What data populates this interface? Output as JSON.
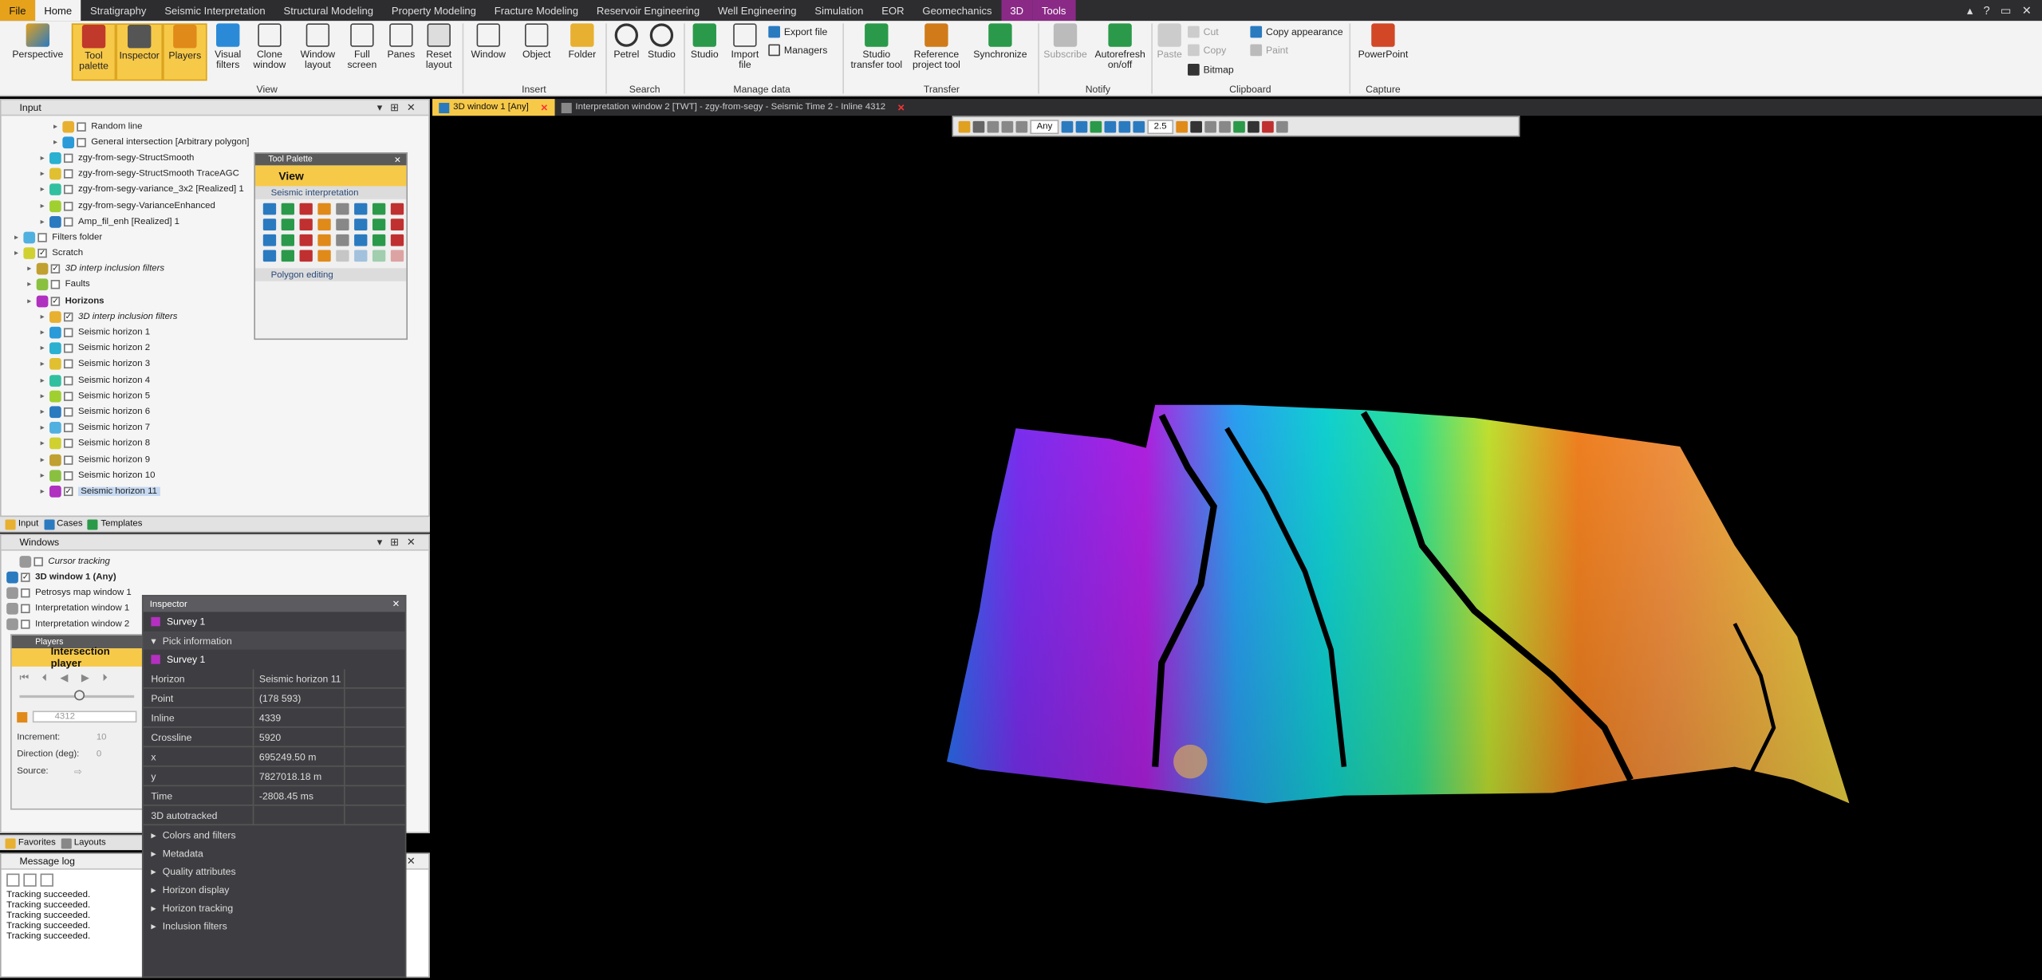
{
  "menu": {
    "tabs": [
      "File",
      "Home",
      "Stratigraphy",
      "Seismic Interpretation",
      "Structural Modeling",
      "Property Modeling",
      "Fracture Modeling",
      "Reservoir Engineering",
      "Well Engineering",
      "Simulation",
      "EOR",
      "Geomechanics",
      "3D",
      "Tools"
    ]
  },
  "ribbon": {
    "buttons": {
      "perspective": "Perspective",
      "tool_palette": "Tool palette",
      "inspector": "Inspector",
      "players": "Players",
      "visual_filters": "Visual filters",
      "clone_window": "Clone window",
      "window_layout": "Window layout",
      "full_screen": "Full screen",
      "panes": "Panes",
      "reset_layout": "Reset layout",
      "window": "Window",
      "object": "Object",
      "folder": "Folder",
      "petrel": "Petrel",
      "studio": "Studio",
      "studio2": "Studio",
      "import_file": "Import file",
      "export_file": "Export file",
      "managers": "Managers",
      "studio_transfer": "Studio transfer tool",
      "reference_project": "Reference project tool",
      "synchronize": "Synchronize",
      "subscribe": "Subscribe",
      "autorefresh": "Autorefresh on/off",
      "paste": "Paste",
      "cut": "Cut",
      "copy": "Copy",
      "bitmap": "Bitmap",
      "copy_appearance": "Copy appearance",
      "paint": "Paint",
      "powerpoint": "PowerPoint"
    },
    "groups": [
      "View",
      "Insert",
      "Search",
      "Manage data",
      "Transfer",
      "Notify",
      "Clipboard",
      "Capture"
    ]
  },
  "input_pane": {
    "title": "Input",
    "rows": [
      {
        "label": "Random line",
        "indent": 4,
        "italic": false,
        "checked": false
      },
      {
        "label": "General intersection [Arbitrary polygon]",
        "indent": 4,
        "italic": false,
        "checked": false
      },
      {
        "label": "zgy-from-segy-StructSmooth",
        "indent": 3,
        "italic": false,
        "checked": false
      },
      {
        "label": "zgy-from-segy-StructSmooth TraceAGC",
        "indent": 3,
        "italic": false,
        "checked": false
      },
      {
        "label": "zgy-from-segy-variance_3x2 [Realized] 1",
        "indent": 3,
        "italic": false,
        "checked": false
      },
      {
        "label": "zgy-from-segy-VarianceEnhanced",
        "indent": 3,
        "italic": false,
        "checked": false
      },
      {
        "label": "Amp_fil_enh [Realized] 1",
        "indent": 3,
        "italic": false,
        "checked": false
      },
      {
        "label": "Filters folder",
        "indent": 1,
        "italic": false,
        "checked": false
      },
      {
        "label": "Scratch",
        "indent": 1,
        "italic": false,
        "checked": true
      },
      {
        "label": "3D interp inclusion filters",
        "indent": 2,
        "italic": true,
        "checked": true
      },
      {
        "label": "Faults",
        "indent": 2,
        "italic": false,
        "checked": false
      },
      {
        "label": "Horizons",
        "indent": 2,
        "italic": false,
        "checked": true
      },
      {
        "label": "3D interp inclusion filters",
        "indent": 3,
        "italic": true,
        "checked": true
      },
      {
        "label": "Seismic horizon 1",
        "indent": 3,
        "italic": false,
        "checked": false
      },
      {
        "label": "Seismic horizon 2",
        "indent": 3,
        "italic": false,
        "checked": false
      },
      {
        "label": "Seismic horizon 3",
        "indent": 3,
        "italic": false,
        "checked": false
      },
      {
        "label": "Seismic horizon 4",
        "indent": 3,
        "italic": false,
        "checked": false
      },
      {
        "label": "Seismic horizon 5",
        "indent": 3,
        "italic": false,
        "checked": false
      },
      {
        "label": "Seismic horizon 6",
        "indent": 3,
        "italic": false,
        "checked": false
      },
      {
        "label": "Seismic horizon 7",
        "indent": 3,
        "italic": false,
        "checked": false
      },
      {
        "label": "Seismic horizon 8",
        "indent": 3,
        "italic": false,
        "checked": false
      },
      {
        "label": "Seismic horizon 9",
        "indent": 3,
        "italic": false,
        "checked": false
      },
      {
        "label": "Seismic horizon 10",
        "indent": 3,
        "italic": false,
        "checked": false
      },
      {
        "label": "Seismic horizon 11",
        "indent": 3,
        "italic": false,
        "checked": true,
        "selected": true
      }
    ],
    "tabs": [
      "Input",
      "Cases",
      "Templates"
    ]
  },
  "windows_pane": {
    "title": "Windows",
    "rows": [
      {
        "label": "Cursor tracking",
        "italic": true
      },
      {
        "label": "3D window 1 (Any)",
        "bold": true
      },
      {
        "label": "Petrosys map window 1"
      },
      {
        "label": "Interpretation window 1"
      },
      {
        "label": "Interpretation window 2"
      }
    ]
  },
  "tool_palette": {
    "title": "Tool Palette",
    "view": "View",
    "section1": "Seismic interpretation",
    "section2": "Polygon editing"
  },
  "players": {
    "title": "Players",
    "intersection": "Intersection player",
    "value": "4312",
    "increment_label": "Increment:",
    "increment": "10",
    "direction_label": "Direction (deg):",
    "direction": "0",
    "source_label": "Source:"
  },
  "bottom_tabs": [
    "Favorites",
    "Layouts"
  ],
  "message_log": {
    "title": "Message log",
    "lines": [
      "Tracking succeeded.",
      "Tracking succeeded.",
      "Tracking succeeded.",
      "Tracking succeeded.",
      "Tracking succeeded."
    ]
  },
  "inspector": {
    "title": "Inspector",
    "survey": "Survey 1",
    "pick_info": "Pick information",
    "survey2": "Survey 1",
    "rows": [
      {
        "k": "Horizon",
        "v": "Seismic horizon 11"
      },
      {
        "k": "Point",
        "v": "(178 593)"
      },
      {
        "k": "Inline",
        "v": "4339"
      },
      {
        "k": "Crossline",
        "v": "5920"
      },
      {
        "k": "x",
        "v": "695249.50 m"
      },
      {
        "k": "y",
        "v": "7827018.18 m"
      },
      {
        "k": "Time",
        "v": "-2808.45 ms"
      },
      {
        "k": "3D autotracked",
        "v": ""
      }
    ],
    "sections": [
      "Colors and filters",
      "Metadata",
      "Quality attributes",
      "Horizon display",
      "Horizon tracking",
      "Inclusion filters"
    ]
  },
  "viewport": {
    "tabs": [
      {
        "label": "3D window 1 [Any]",
        "active": true
      },
      {
        "label": "Interpretation window 2 [TWT] - zgy-from-segy - Seismic Time 2 - Inline 4312",
        "active": false
      }
    ],
    "toolbar_domain": "Any",
    "toolbar_zscale": "2.5"
  },
  "colors": {
    "accent": "#f7c948",
    "file_tab": "#e6a21b",
    "ctx_tab": "#8a2a86"
  }
}
